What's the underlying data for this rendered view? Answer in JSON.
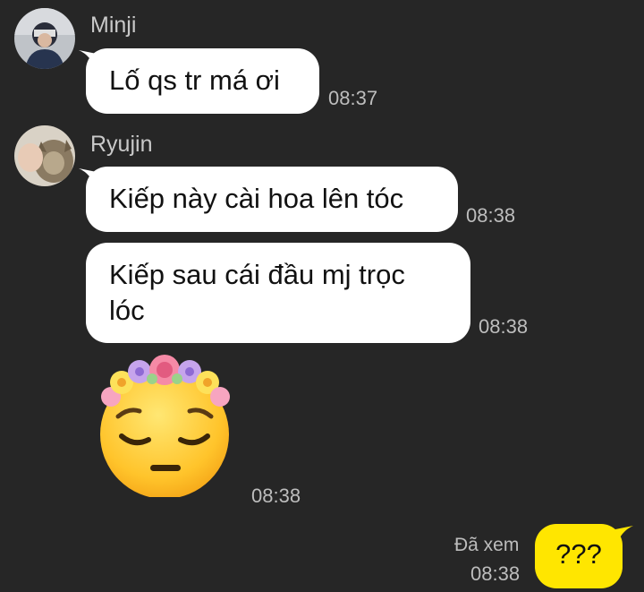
{
  "messages": [
    {
      "sender": "Minji",
      "text": "Lố qs tr má ơi",
      "time": "08:37"
    },
    {
      "sender": "Ryujin",
      "text": "Kiếp này cài hoa lên tóc",
      "time": "08:38"
    },
    {
      "sender": "Ryujin",
      "text": "Kiếp sau cái đầu mj trọc lóc",
      "time": "08:38"
    },
    {
      "sender": "Ryujin",
      "sticker": "pensive-flower-crown-emoji",
      "time": "08:38"
    },
    {
      "sender": "me",
      "text": "???",
      "time": "08:38",
      "status": "Đã xem"
    }
  ],
  "colors": {
    "background": "#262626",
    "incoming_bubble": "#ffffff",
    "outgoing_bubble": "#ffe600"
  }
}
